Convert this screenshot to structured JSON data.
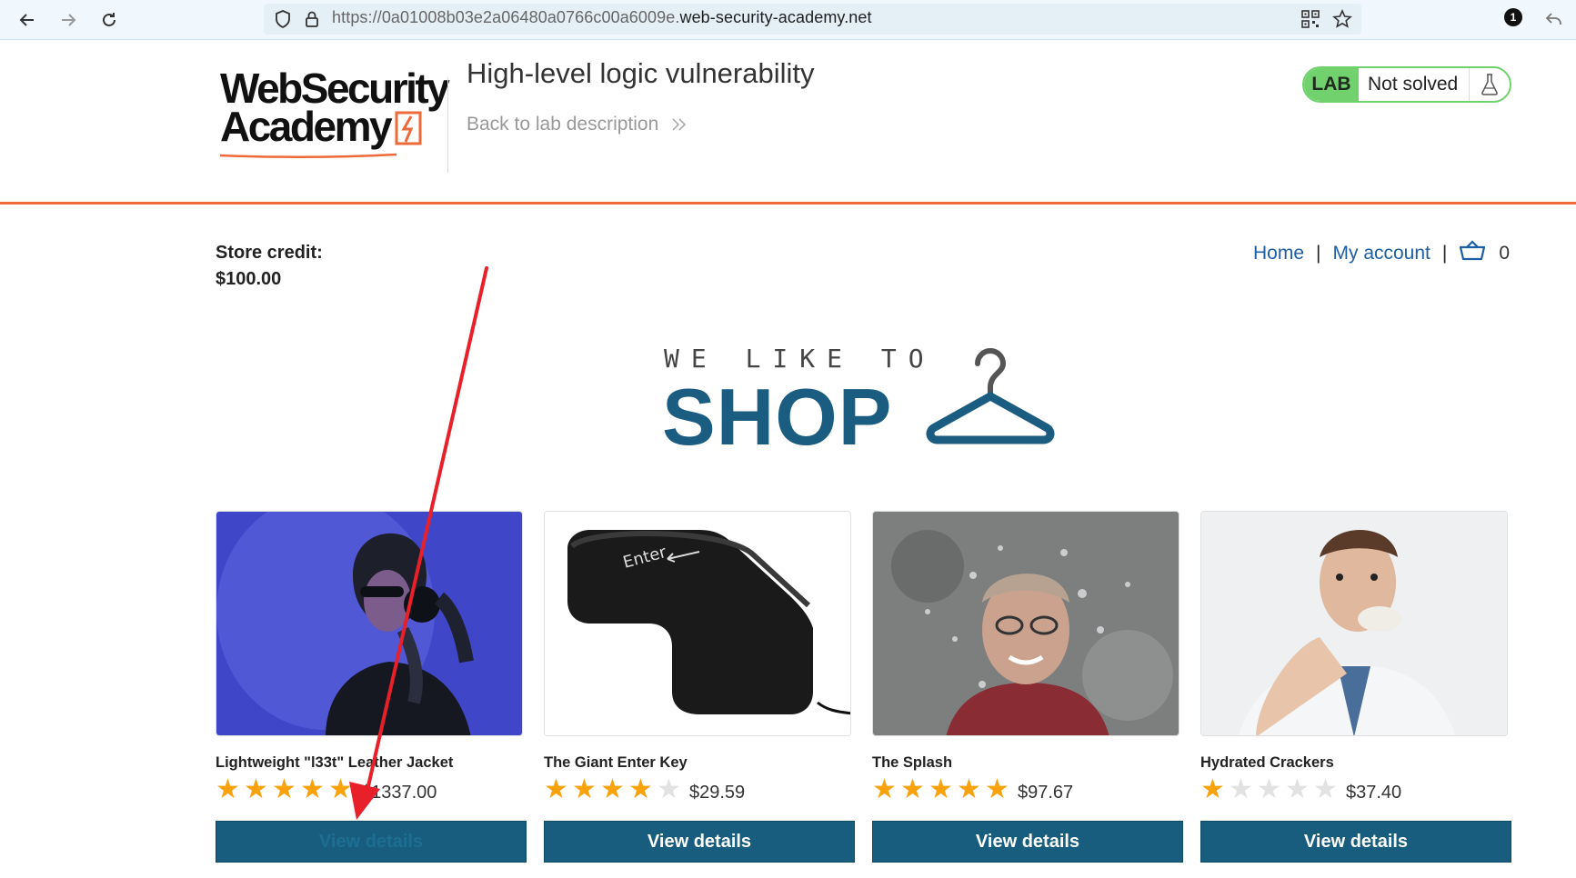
{
  "browser": {
    "url_prefix": "https://0a01008b03e2a06480a0766c00a6009e.",
    "url_domain": "web-security-academy.net",
    "notification_count": "1"
  },
  "academy": {
    "logo_line1": "WebSecurity",
    "logo_line2": "Academy",
    "lab_title": "High-level logic vulnerability",
    "back_link": "Back to lab description",
    "lab_badge": "LAB",
    "lab_state": "Not solved"
  },
  "store": {
    "credit_label": "Store credit:",
    "credit_value": "$100.00"
  },
  "nav": {
    "home": "Home",
    "separator": "|",
    "my_account": "My account",
    "cart_count": "0"
  },
  "hero": {
    "small": "WE LIKE TO",
    "big": "SHOP"
  },
  "products": [
    {
      "name": "Lightweight \"l33t\" Leather Jacket",
      "rating": 5,
      "price": "$1337.00",
      "button": "View details"
    },
    {
      "name": "The Giant Enter Key",
      "rating": 4,
      "price": "$29.59",
      "button": "View details"
    },
    {
      "name": "The Splash",
      "rating": 5,
      "price": "$97.67",
      "button": "View details"
    },
    {
      "name": "Hydrated Crackers",
      "rating": 1,
      "price": "$37.40",
      "button": "View details"
    }
  ],
  "colors": {
    "accent_orange": "#ef6a3a",
    "brand_blue": "#185d7e",
    "lab_green": "#70d16d",
    "star": "#f9a20c",
    "annotation_arrow": "#e8202a"
  }
}
